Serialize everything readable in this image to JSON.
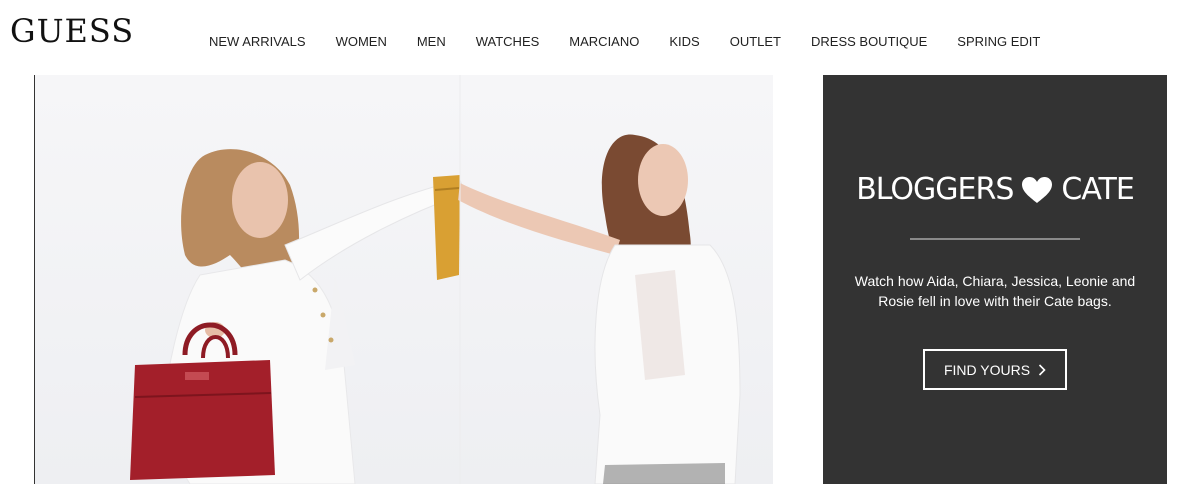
{
  "brand": {
    "logo_text": "GUESS"
  },
  "nav": {
    "items": [
      {
        "label": "NEW ARRIVALS"
      },
      {
        "label": "WOMEN"
      },
      {
        "label": "MEN"
      },
      {
        "label": "WATCHES"
      },
      {
        "label": "MARCIANO"
      },
      {
        "label": "KIDS"
      },
      {
        "label": "OUTLET"
      },
      {
        "label": "DRESS BOUTIQUE"
      },
      {
        "label": "SPRING EDIT"
      }
    ]
  },
  "promo": {
    "title_before": "BLOGGERS",
    "title_icon": "heart-icon",
    "title_after": "CATE",
    "description": "Watch how Aida, Chiara, Jessica, Leonie and Rosie fell in love with their Cate bags.",
    "cta_label": "FIND YOURS",
    "cta_icon": "chevron-right-icon"
  },
  "colors": {
    "panel_bg": "#333333",
    "text_light": "#ffffff",
    "bag_red": "#a31f2a",
    "bag_mustard": "#d9a033"
  }
}
